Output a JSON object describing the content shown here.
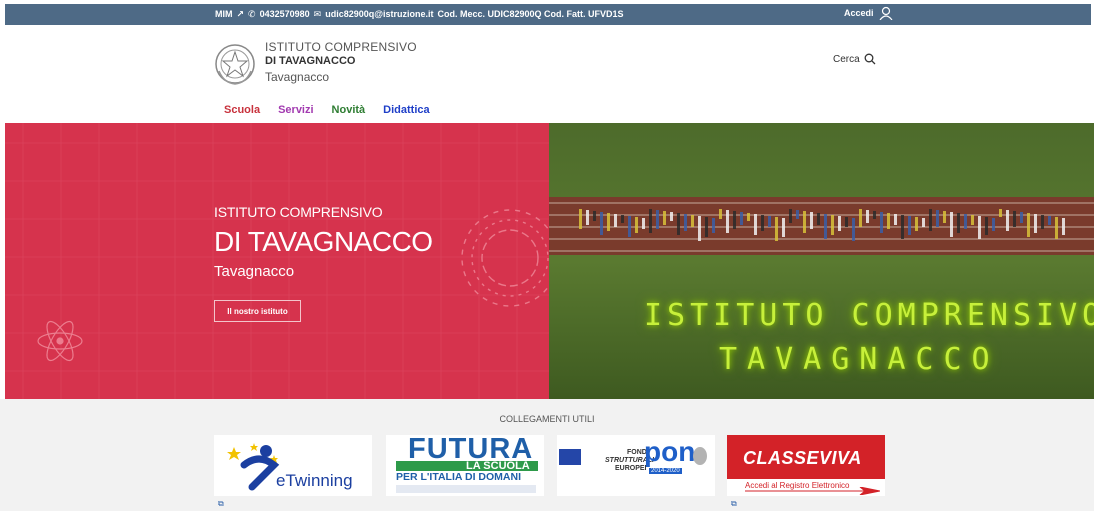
{
  "topbar": {
    "mim": "MIM",
    "phone": "0432570980",
    "email": "udic82900q@istruzione.it",
    "codes": "Cod. Mecc. UDIC82900Q Cod. Fatt. UFVD1S",
    "login": "Accedi"
  },
  "header": {
    "line1": "ISTITUTO COMPRENSIVO",
    "line2": "DI TAVAGNACCO",
    "line3": "Tavagnacco",
    "search": "Cerca"
  },
  "nav": [
    {
      "label": "Scuola",
      "color": "#c8323d"
    },
    {
      "label": "Servizi",
      "color": "#a23ab0"
    },
    {
      "label": "Novità",
      "color": "#2e7d32"
    },
    {
      "label": "Didattica",
      "color": "#1f3fc8"
    }
  ],
  "hero": {
    "pre": "ISTITUTO COMPRENSIVO",
    "title": "DI TAVAGNACCO",
    "sub": "Tavagnacco",
    "button": "Il nostro istituto",
    "neon1": "ISTITUTO COMPRENSIVO",
    "neon2": "TAVAGNACCO",
    "accent": "#d6334d"
  },
  "links": {
    "title": "COLLEGAMENTI UTILI",
    "etwinning": "eTwinning",
    "futura1": "FUTURA",
    "futura2": "LA SCUOLA",
    "futura3": "PER L'ITALIA DI DOMANI",
    "pon1": "FONDI",
    "pon2": "STRUTTURALI",
    "pon3": "EUROPEI",
    "pon4": "pon",
    "pon5": "2014-2020",
    "classeviva": "CLASSEVIVA",
    "registro": "Accedi al Registro Elettronico"
  }
}
